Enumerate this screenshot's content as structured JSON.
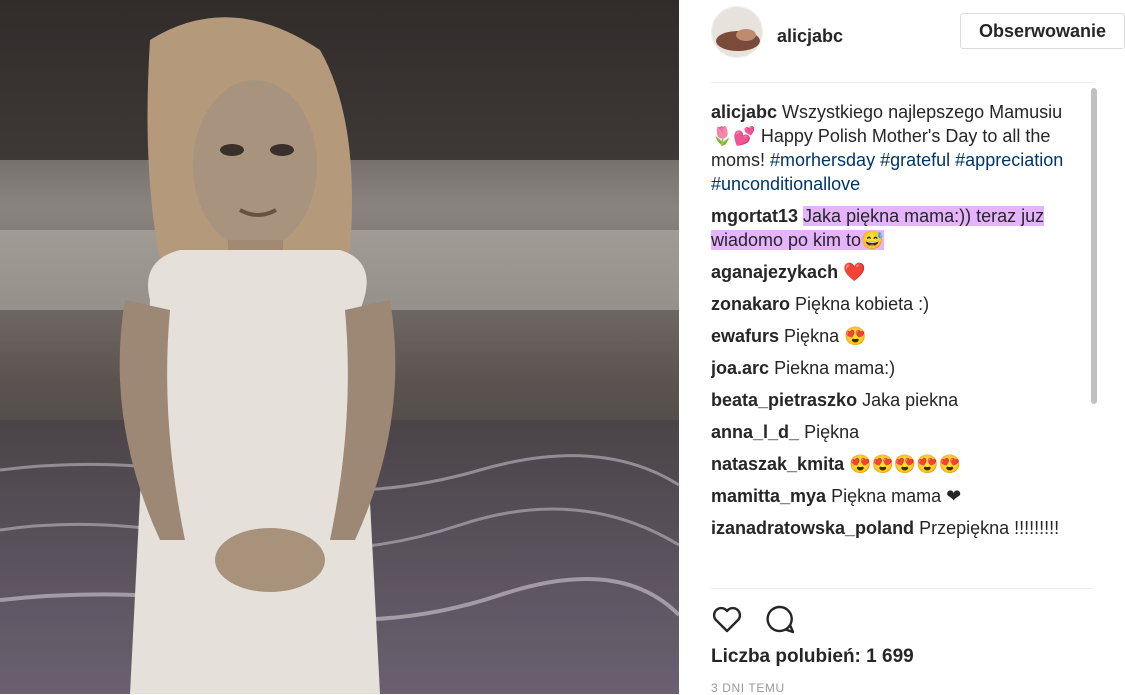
{
  "post": {
    "username": "alicjabc",
    "follow_label": "Obserwowanie",
    "caption": {
      "author": "alicjabc",
      "text_1": " Wszystkiego najlepszego Mamusiu ",
      "emoji_1": "🌷💕",
      "text_2": " Happy Polish Mother's Day to all the moms! ",
      "hashtags": [
        "#morhersday",
        "#grateful",
        "#appreciation",
        "#unconditionallove"
      ]
    },
    "comments": [
      {
        "author": "mgortat13",
        "text": "Jaka piękna mama:)) teraz juz wiadomo po kim to",
        "emoji": "😅",
        "highlighted": true
      },
      {
        "author": "aganajezykach",
        "text": "",
        "emoji": "❤️"
      },
      {
        "author": "zonakaro",
        "text": "Piękna kobieta :)",
        "emoji": ""
      },
      {
        "author": "ewafurs",
        "text": "Piękna",
        "emoji": "😍"
      },
      {
        "author": "joa.arc",
        "text": "Piekna mama:)",
        "emoji": ""
      },
      {
        "author": "beata_pietraszko",
        "text": "Jaka piekna",
        "emoji": ""
      },
      {
        "author": "anna_l_d_",
        "text": "Piękna",
        "emoji": ""
      },
      {
        "author": "nataszak_kmita",
        "text": "",
        "emoji": "😍😍😍😍😍"
      },
      {
        "author": "mamitta_mya",
        "text": "Piękna mama",
        "emoji": "❤"
      },
      {
        "author": "izanadratowska_poland",
        "text": "Przepiękna !!!!!!!!!",
        "emoji": ""
      }
    ],
    "likes_label": "Liczba polubień: 1 699",
    "timestamp": "3 DNI TEMU",
    "icons": {
      "like": "heart-outline-icon",
      "comment": "speech-bubble-icon"
    },
    "colors": {
      "hashtag": "#003569",
      "highlight": "#e6b3ff",
      "border": "#dbdbdb"
    }
  }
}
